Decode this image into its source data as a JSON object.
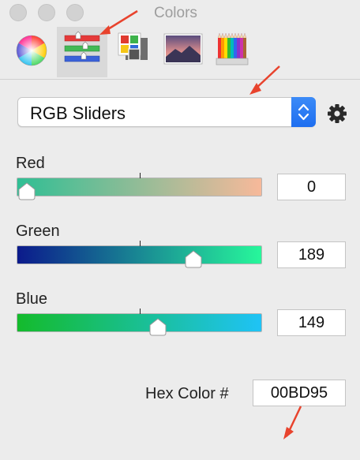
{
  "window": {
    "title": "Colors"
  },
  "toolbar": {
    "tabs": [
      {
        "name": "color-wheel",
        "icon": "color-wheel-icon",
        "selected": false
      },
      {
        "name": "color-sliders",
        "icon": "sliders-icon",
        "selected": true
      },
      {
        "name": "color-palettes",
        "icon": "palettes-icon",
        "selected": false
      },
      {
        "name": "image-palettes",
        "icon": "image-icon",
        "selected": false
      },
      {
        "name": "pencils",
        "icon": "pencils-icon",
        "selected": false
      }
    ]
  },
  "mode_select": {
    "value": "RGB Sliders"
  },
  "sliders": [
    {
      "label": "Red",
      "value": "0",
      "fraction": 0.0
    },
    {
      "label": "Green",
      "value": "189",
      "fraction": 0.741
    },
    {
      "label": "Blue",
      "value": "149",
      "fraction": 0.584
    }
  ],
  "hex": {
    "label": "Hex Color #",
    "value": "00BD95"
  },
  "colors": {
    "accent": "#1d6ef0",
    "annotation_arrow": "#e8432d",
    "current_color": "#00BD95"
  }
}
